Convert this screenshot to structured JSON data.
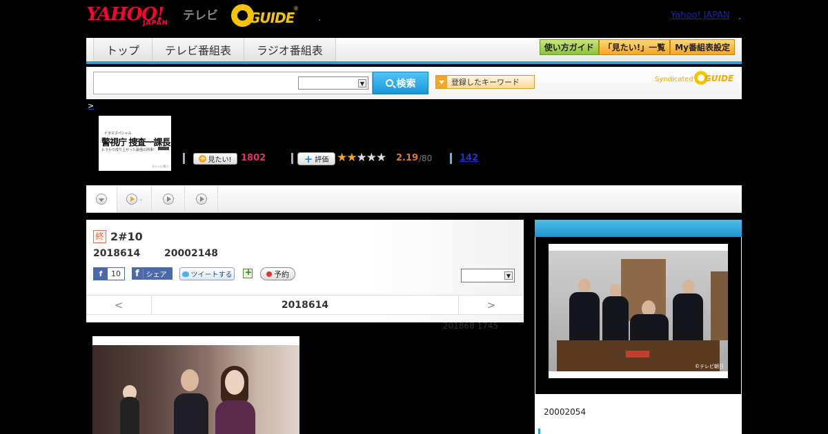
{
  "header": {
    "logo_text": "YAHOO!",
    "logo_japan": "JAPAN",
    "tv_label": "テレビ",
    "gguide_logo": "GUIDE",
    "yahoo_link": "Yahoo! JAPAN"
  },
  "nav": {
    "tabs": [
      "トップ",
      "テレビ番組表",
      "ラジオ番組表"
    ],
    "buttons": [
      "使い方ガイド",
      "「見たい!」一覧",
      "My番組表設定"
    ]
  },
  "search": {
    "input_value": "",
    "select_value": "",
    "button_label": "検索",
    "keyword_button": "登録したキーワード",
    "syndicated_label": "Syndicated",
    "syndicated_logo": "GUIDE"
  },
  "breadcrumb": ">",
  "program": {
    "poster_small": "ドラマスペシャル",
    "poster_title": "警視庁 捜査一課長",
    "poster_sub": "ヒラから成り上がった最強の刑事!",
    "poster_copy": "©テレビ朝日",
    "mitai_label": "見たい!",
    "mitai_count": "1802",
    "hyoka_label": "評価",
    "rating": 2.19,
    "rating_text": "2.19",
    "rating_of": "/80",
    "review_count": "142"
  },
  "subtabs": {
    "tab2_suffix": "."
  },
  "episode": {
    "status_badge": "終",
    "title": "2#10",
    "date": "2018614",
    "id": "20002148",
    "fb_like_count": "10",
    "fb_share_label": "シェア",
    "tweet_label": "ツイートする",
    "reserve_label": "予約",
    "select_value": "",
    "prev_label": "<",
    "current_date": "2018614",
    "next_label": ">",
    "air_info": "201868  1745"
  },
  "sidebar": {
    "photo_copy": "©テレビ朝日",
    "program_id": "20002054"
  },
  "colors": {
    "accent_blue": "#27a0d8",
    "mitai_pink": "#e0336e",
    "score_orange": "#e07b22",
    "star_on": "#f5a623"
  }
}
